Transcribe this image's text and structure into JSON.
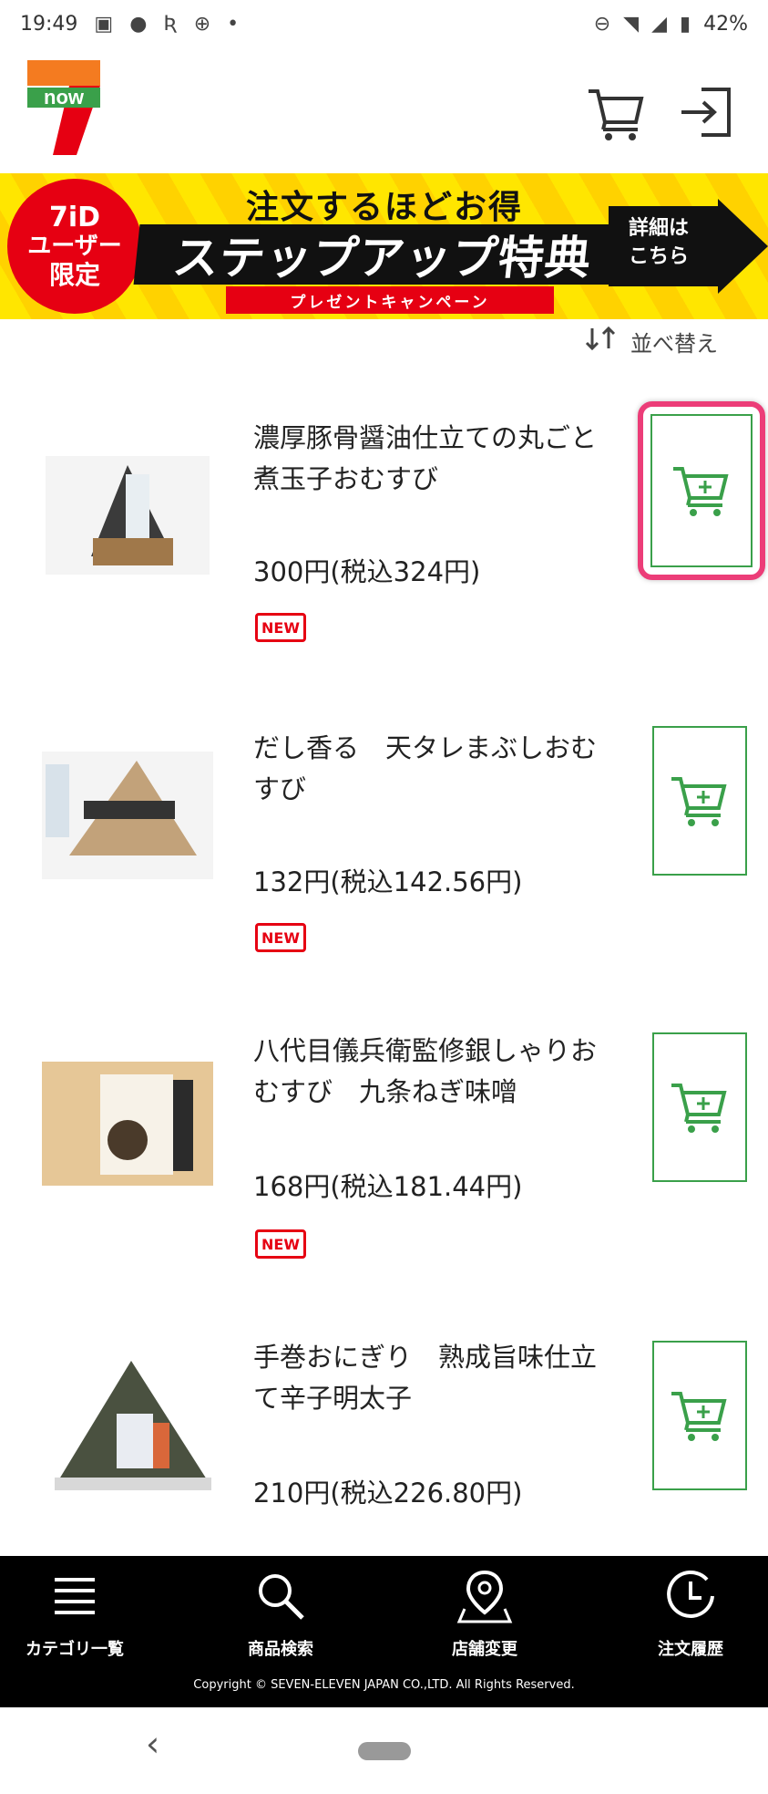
{
  "status_bar": {
    "time": "19:49",
    "battery": "42%",
    "icons": [
      "image-icon",
      "line-icon",
      "r-icon",
      "bolt-icon",
      "dot-icon",
      "dnd-icon",
      "wifi-icon",
      "signal-icon",
      "battery-icon"
    ]
  },
  "header": {
    "logo_mark": "7",
    "logo_text": "now"
  },
  "banner": {
    "badge_line1": "7iD",
    "badge_line2": "ユーザー",
    "badge_line3": "限定",
    "subtitle": "注文するほどお得",
    "title": "ステップアップ特典",
    "ribbon": "プレゼントキャンペーン",
    "cta_line1": "詳細は",
    "cta_line2": "こちら"
  },
  "sort": {
    "label": "並べ替え"
  },
  "products": [
    {
      "name": "濃厚豚骨醤油仕立ての丸ごと煮玉子おむすび",
      "price": "300円(税込324円)",
      "badge": "NEW"
    },
    {
      "name": "だし香る　天タレまぶしおむすび",
      "price": "132円(税込142.56円)",
      "badge": "NEW"
    },
    {
      "name": "八代目儀兵衛監修銀しゃりおむすび　九条ねぎ味噌",
      "price": "168円(税込181.44円)",
      "badge": "NEW"
    },
    {
      "name": "手巻おにぎり　熟成旨味仕立て辛子明太子",
      "price": "210円(税込226.80円)",
      "badge": ""
    }
  ],
  "bottom_nav": {
    "items": [
      {
        "label": "カテゴリ一覧",
        "icon": "menu-icon"
      },
      {
        "label": "商品検索",
        "icon": "search-icon"
      },
      {
        "label": "店舗変更",
        "icon": "map-pin-icon"
      },
      {
        "label": "注文履歴",
        "icon": "clock-icon"
      }
    ],
    "copyright": "Copyright © SEVEN-ELEVEN JAPAN CO.,LTD. All Rights Reserved."
  },
  "colors": {
    "brand_orange": "#f47b20",
    "brand_red": "#e60012",
    "brand_green": "#3aa04a",
    "highlight_pink": "#ec3d78"
  }
}
